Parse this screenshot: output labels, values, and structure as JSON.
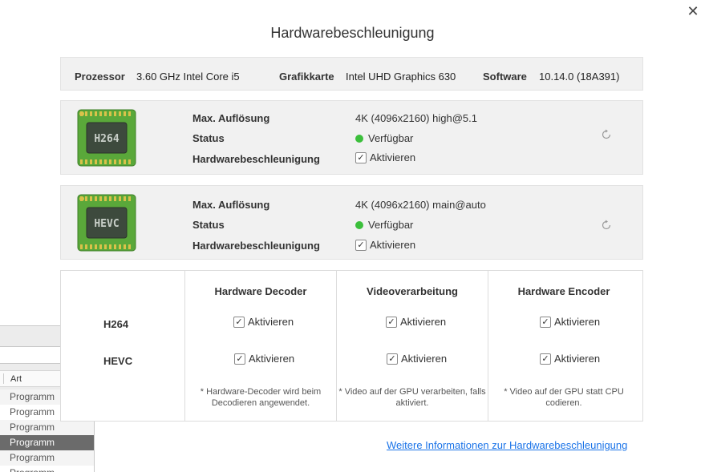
{
  "window": {
    "title": "Hardwarebeschleunigung",
    "close_label": "✕"
  },
  "info": {
    "processor_label": "Prozessor",
    "processor_value": "3.60 GHz Intel Core i5",
    "gpu_label": "Grafikkarte",
    "gpu_value": "Intel UHD Graphics 630",
    "software_label": "Software",
    "software_value": "10.14.0 (18A391)"
  },
  "codecs": [
    {
      "chip_label": "H264",
      "max_res_label": "Max. Auflösung",
      "max_res_value": "4K (4096x2160) high@5.1",
      "status_label": "Status",
      "status_value": "Verfügbar",
      "hw_label": "Hardwarebeschleunigung",
      "hw_value": "Aktivieren",
      "hw_checked": true
    },
    {
      "chip_label": "HEVC",
      "max_res_label": "Max. Auflösung",
      "max_res_value": "4K (4096x2160) main@auto",
      "status_label": "Status",
      "status_value": "Verfügbar",
      "hw_label": "Hardwarebeschleunigung",
      "hw_value": "Aktivieren",
      "hw_checked": true
    }
  ],
  "matrix": {
    "columns": [
      "Hardware Decoder",
      "Videoverarbeitung",
      "Hardware Encoder"
    ],
    "rows": [
      "H264",
      "HEVC"
    ],
    "checkbox_label": "Aktivieren",
    "notes": [
      "* Hardware-Decoder wird beim Decodieren angewendet.",
      "* Video auf der GPU verarbeiten, falls aktiviert.",
      "* Video auf der GPU statt CPU codieren."
    ]
  },
  "link": {
    "text": "Weitere Informationen zur Hardwarebeschleunigung"
  },
  "background_window": {
    "column_header": "Art",
    "rows": [
      "Programm",
      "Programm",
      "Programm",
      "Programm",
      "Programm",
      "Programm"
    ],
    "selected_index": 3
  },
  "colors": {
    "status_ok": "#3bbf3b",
    "link": "#1a73e8",
    "chip_green": "#5aa83a",
    "chip_core": "#3d4a3d"
  }
}
